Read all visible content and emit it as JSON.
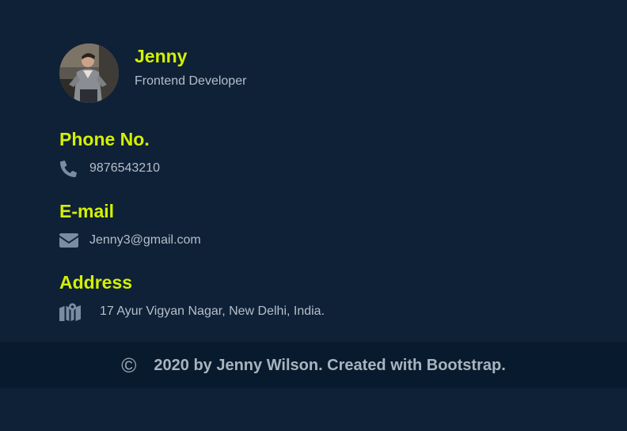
{
  "profile": {
    "name": "Jenny",
    "role": "Frontend Developer"
  },
  "contact": {
    "phone": {
      "heading": "Phone No.",
      "value": "9876543210",
      "icon": "phone-icon"
    },
    "email": {
      "heading": "E-mail",
      "value": "Jenny3@gmail.com",
      "icon": "envelope-icon"
    },
    "address": {
      "heading": "Address",
      "value": "17 Ayur Vigyan Nagar, New Delhi, India.",
      "icon": "map-icon"
    }
  },
  "footer": {
    "copyright_symbol": "©",
    "text": "2020 by Jenny Wilson. Created with Bootstrap."
  },
  "colors": {
    "background": "#0f2137",
    "footer_background": "#081a2d",
    "accent": "#d4f000",
    "text": "#b5bfca",
    "icon": "#7a8ca1"
  }
}
